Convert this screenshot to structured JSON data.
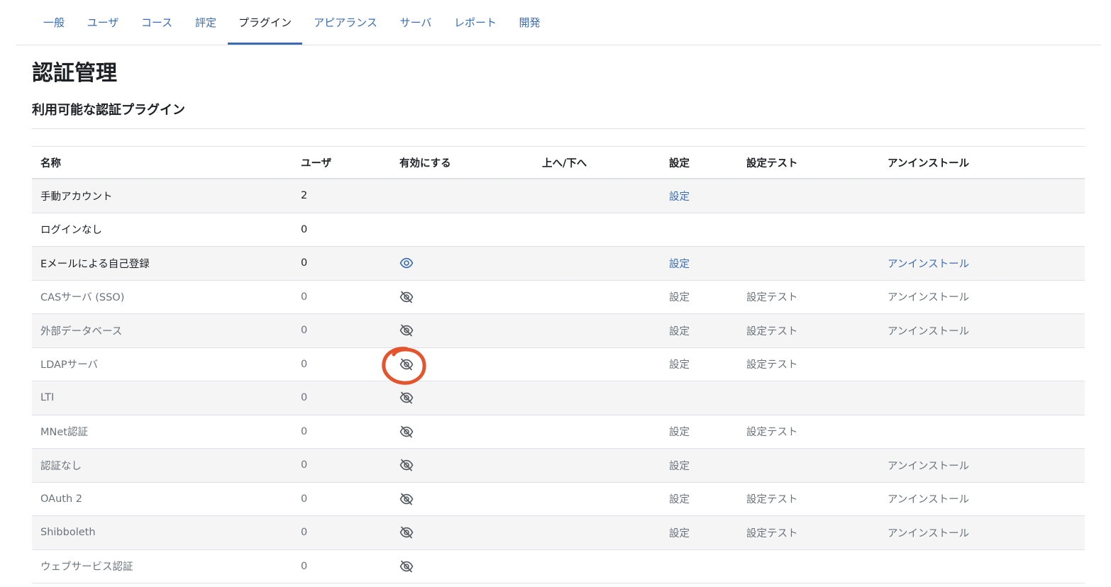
{
  "tabs": [
    {
      "label": "一般",
      "active": false
    },
    {
      "label": "ユーザ",
      "active": false
    },
    {
      "label": "コース",
      "active": false
    },
    {
      "label": "評定",
      "active": false
    },
    {
      "label": "プラグイン",
      "active": true
    },
    {
      "label": "アピアランス",
      "active": false
    },
    {
      "label": "サーバ",
      "active": false
    },
    {
      "label": "レポート",
      "active": false
    },
    {
      "label": "開発",
      "active": false
    }
  ],
  "page_title": "認証管理",
  "section_title": "利用可能な認証プラグイン",
  "table": {
    "headers": {
      "name": "名称",
      "users": "ユーザ",
      "enable": "有効にする",
      "updown": "上へ/下へ",
      "settings": "設定",
      "test": "設定テスト",
      "uninstall": "アンインストール"
    },
    "rows": [
      {
        "name": "手動アカウント",
        "users": "2",
        "enable_icon": "",
        "settings": "設定",
        "test": "",
        "uninstall": "",
        "state": "enabled"
      },
      {
        "name": "ログインなし",
        "users": "0",
        "enable_icon": "",
        "settings": "",
        "test": "",
        "uninstall": "",
        "state": "enabled"
      },
      {
        "name": "Eメールによる自己登録",
        "users": "0",
        "enable_icon": "eye-icon",
        "settings": "設定",
        "test": "",
        "uninstall": "アンインストール",
        "state": "enabled"
      },
      {
        "name": "CASサーバ (SSO)",
        "users": "0",
        "enable_icon": "eye-slash-icon",
        "settings": "設定",
        "test": "設定テスト",
        "uninstall": "アンインストール",
        "state": "disabled"
      },
      {
        "name": "外部データベース",
        "users": "0",
        "enable_icon": "eye-slash-icon",
        "settings": "設定",
        "test": "設定テスト",
        "uninstall": "アンインストール",
        "state": "disabled"
      },
      {
        "name": "LDAPサーバ",
        "users": "0",
        "enable_icon": "eye-slash-icon",
        "settings": "設定",
        "test": "設定テスト",
        "uninstall": "",
        "state": "disabled"
      },
      {
        "name": "LTI",
        "users": "0",
        "enable_icon": "eye-slash-icon",
        "settings": "",
        "test": "",
        "uninstall": "",
        "state": "disabled"
      },
      {
        "name": "MNet認証",
        "users": "0",
        "enable_icon": "eye-slash-icon",
        "settings": "設定",
        "test": "設定テスト",
        "uninstall": "",
        "state": "disabled"
      },
      {
        "name": "認証なし",
        "users": "0",
        "enable_icon": "eye-slash-icon",
        "settings": "設定",
        "test": "",
        "uninstall": "アンインストール",
        "state": "disabled"
      },
      {
        "name": "OAuth 2",
        "users": "0",
        "enable_icon": "eye-slash-icon",
        "settings": "設定",
        "test": "設定テスト",
        "uninstall": "アンインストール",
        "state": "disabled"
      },
      {
        "name": "Shibboleth",
        "users": "0",
        "enable_icon": "eye-slash-icon",
        "settings": "設定",
        "test": "設定テスト",
        "uninstall": "アンインストール",
        "state": "disabled"
      },
      {
        "name": "ウェブサービス認証",
        "users": "0",
        "enable_icon": "eye-slash-icon",
        "settings": "",
        "test": "",
        "uninstall": "",
        "state": "disabled"
      }
    ]
  },
  "colors": {
    "link": "#3b6cb4",
    "text": "#1d2125",
    "muted": "#6a737b",
    "stripe": "#f5f5f5",
    "annotation": "#e2471b"
  },
  "annotation": {
    "shape": "hand-drawn-circle",
    "target": "LDAPサーバ enable eye-slash-icon"
  }
}
